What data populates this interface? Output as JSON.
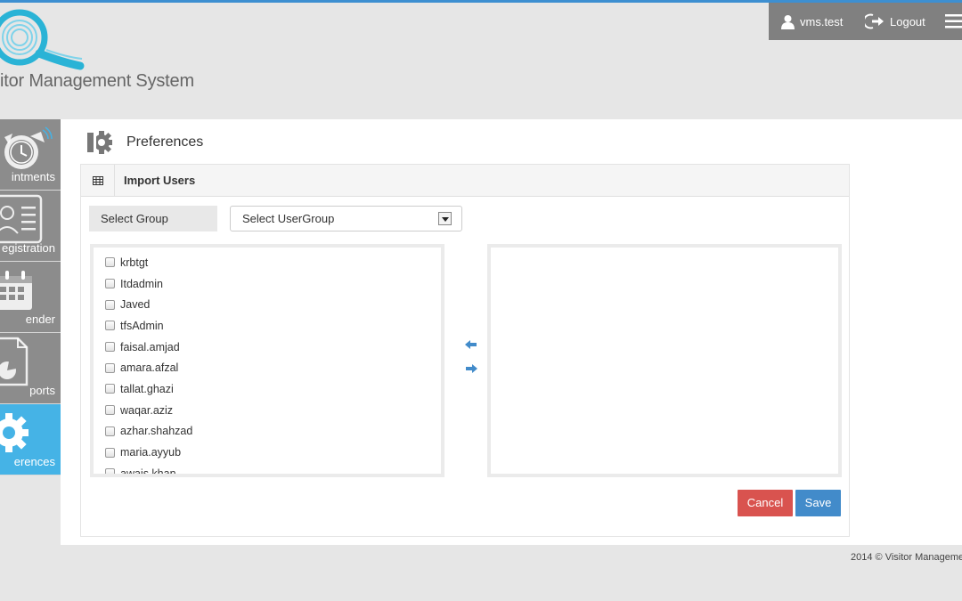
{
  "header": {
    "logo_text": "itor Management System",
    "username": "vms.test",
    "logout_label": "Logout"
  },
  "sidebar": {
    "items": [
      {
        "label": "intments",
        "icon": "alarm-clock-icon",
        "active": false
      },
      {
        "label": "egistration",
        "icon": "id-card-icon",
        "active": false
      },
      {
        "label": "ender",
        "icon": "calendar-icon",
        "active": false
      },
      {
        "label": "ports",
        "icon": "report-icon",
        "active": false
      },
      {
        "label": "erences",
        "icon": "gear-icon",
        "active": true
      }
    ]
  },
  "page": {
    "title": "Preferences",
    "panel_title": "Import Users",
    "group_label": "Select Group",
    "group_select_value": "Select UserGroup",
    "users": [
      "krbtgt",
      "Itdadmin",
      "Javed",
      "tfsAdmin",
      "faisal.amjad",
      "amara.afzal",
      "tallat.ghazi",
      "waqar.aziz",
      "azhar.shahzad",
      "maria.ayyub",
      "awais.khan"
    ],
    "cancel_label": "Cancel",
    "save_label": "Save"
  },
  "footer": {
    "text": "2014 © Visitor Manageme"
  },
  "colors": {
    "accent": "#45b3e6",
    "sidebar": "#8c8c8c",
    "cancel": "#d9534f",
    "save": "#428bca"
  }
}
